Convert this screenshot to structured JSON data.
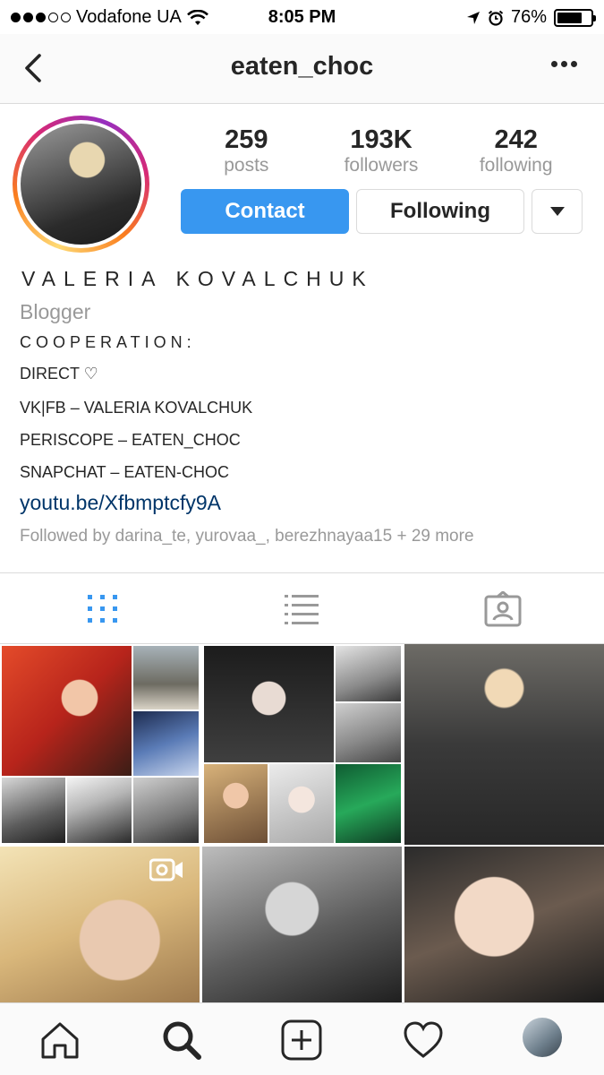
{
  "status_bar": {
    "carrier": "Vodafone UA",
    "signal_bars": 3,
    "signal_total": 5,
    "time": "8:05 PM",
    "battery_text": "76%",
    "battery_level": 0.76
  },
  "nav": {
    "title": "eaten_choc",
    "back_icon": "chevron-left-icon",
    "more_icon": "more-horizontal-icon"
  },
  "profile": {
    "stats": [
      {
        "value": "259",
        "label": "posts"
      },
      {
        "value": "193K",
        "label": "followers"
      },
      {
        "value": "242",
        "label": "following"
      }
    ],
    "contact_label": "Contact",
    "following_label": "Following"
  },
  "bio": {
    "name": "VALERIA KOVALCHUK",
    "category": "Blogger",
    "lines": [
      "COOPERATION:",
      "DIRECT ♡",
      "VK|FB – VALERIA KOVALCHUK",
      "PERISCOPE – EATEN_CHOC",
      "SNAPCHAT – EATEN-CHOC"
    ],
    "link": "youtu.be/Xfbmptcfy9A",
    "followed_by": "Followed by darina_te, yurovaa_, berezhnayaa15 + 29 more"
  },
  "tabs": [
    "grid-icon",
    "list-icon",
    "tagged-icon"
  ],
  "grid": {
    "video_badge": "video-camera-icon"
  },
  "bottom_nav": [
    "home-icon",
    "search-icon",
    "add-icon",
    "heart-icon",
    "profile-avatar"
  ],
  "colors": {
    "accent": "#3897f0",
    "link": "#003569",
    "muted": "#999999"
  }
}
